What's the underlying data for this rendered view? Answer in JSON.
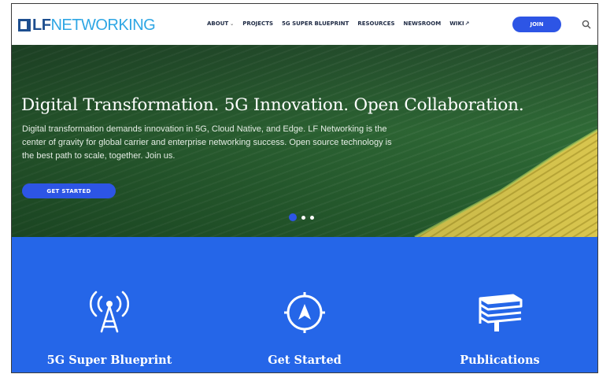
{
  "nav": {
    "logo": {
      "lf": "LF",
      "networking": "NETWORKING"
    },
    "items": [
      {
        "label": "ABOUT",
        "caret": "⌄"
      },
      {
        "label": "PROJECTS"
      },
      {
        "label": "5G SUPER BLUEPRINT"
      },
      {
        "label": "RESOURCES"
      },
      {
        "label": "NEWSROOM"
      },
      {
        "label": "WIKI",
        "external_icon": "↗"
      }
    ],
    "join_label": "JOIN",
    "search_icon": "search-icon"
  },
  "hero": {
    "title": "Digital Transformation. 5G Innovation. Open Collaboration.",
    "text": "Digital transformation demands innovation in 5G, Cloud Native, and Edge. LF Networking is the center of gravity for global carrier and enterprise networking success. Open source technology is the best path to scale, together. Join us.",
    "cta_label": "GET STARTED",
    "carousel": {
      "slides": 3,
      "active": 1
    }
  },
  "features": [
    {
      "label": "5G Super Blueprint",
      "icon": "antenna-tower-icon"
    },
    {
      "label": "Get Started",
      "icon": "compass-icon"
    },
    {
      "label": "Publications",
      "icon": "books-icon"
    }
  ],
  "colors": {
    "brand_blue": "#2d55e5",
    "feature_bg": "#2566e8",
    "logo_dark": "#1d4e8f",
    "logo_light": "#2ea6e4"
  }
}
